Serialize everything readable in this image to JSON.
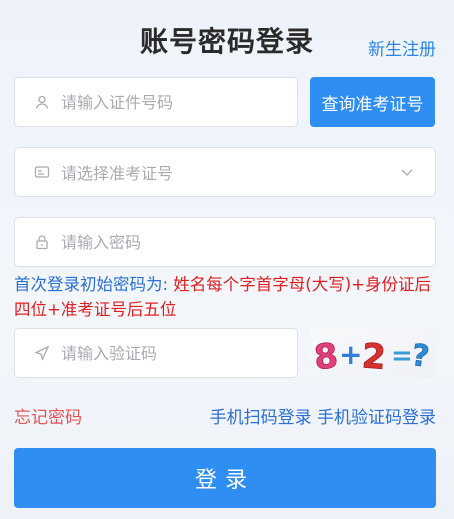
{
  "header": {
    "title": "账号密码登录",
    "register_link": "新生注册"
  },
  "form": {
    "id_field": {
      "placeholder": "请输入证件号码",
      "icon": "user-icon"
    },
    "query_button": "查询准考证号",
    "exam_select": {
      "placeholder": "请选择准考证号",
      "icon": "id-card-icon"
    },
    "password_field": {
      "placeholder": "请输入密码",
      "icon": "lock-icon"
    },
    "hint_prefix": "首次登录初始密码为:",
    "hint_rule": " 姓名每个字首字母(大写)+身份证后四位+准考证号后五位",
    "captcha_field": {
      "placeholder": "请输入验证码",
      "icon": "send-icon"
    },
    "captcha_image": "8+2=?",
    "forgot_link": "忘记密码",
    "scan_login_link": "手机扫码登录",
    "sms_login_link": "手机验证码登录",
    "login_button": "登录"
  },
  "colors": {
    "primary": "#2e8ef2",
    "link_blue": "#2a6fd6",
    "danger_red": "#e02020",
    "forgot_red": "#e25555"
  }
}
